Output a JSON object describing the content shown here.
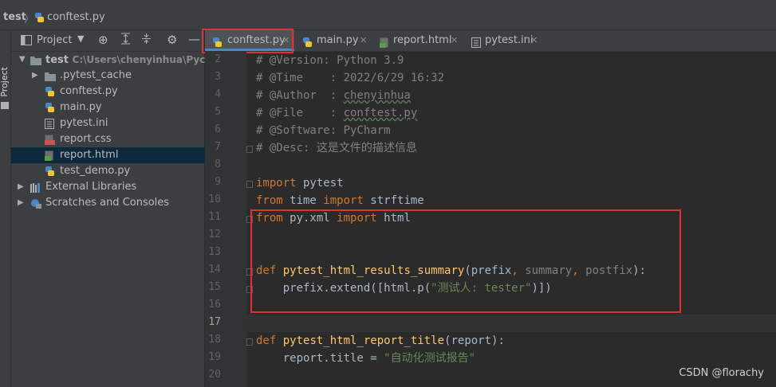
{
  "breadcrumb": {
    "project": "test",
    "file": "conftest.py"
  },
  "left_strip": {
    "label": "Project"
  },
  "project_panel": {
    "view_label": "Project",
    "tree": [
      {
        "label": "test",
        "path": "C:\\Users\\chenyinhua\\Pycharm",
        "kind": "project-folder"
      },
      {
        "label": ".pytest_cache",
        "kind": "folder"
      },
      {
        "label": "conftest.py",
        "kind": "python-file"
      },
      {
        "label": "main.py",
        "kind": "python-file"
      },
      {
        "label": "pytest.ini",
        "kind": "ini-file"
      },
      {
        "label": "report.css",
        "kind": "css-file"
      },
      {
        "label": "report.html",
        "kind": "html-file",
        "selected": true
      },
      {
        "label": "test_demo.py",
        "kind": "python-file"
      },
      {
        "label": "External Libraries",
        "kind": "libraries"
      },
      {
        "label": "Scratches and Consoles",
        "kind": "scratches"
      }
    ]
  },
  "tabs": [
    {
      "label": "conftest.py",
      "active": true
    },
    {
      "label": "main.py"
    },
    {
      "label": "report.html"
    },
    {
      "label": "pytest.ini"
    }
  ],
  "editor": {
    "current_line": 17,
    "line_numbers": [
      "2",
      "3",
      "4",
      "5",
      "6",
      "7",
      "8",
      "9",
      "10",
      "11",
      "12",
      "13",
      "14",
      "15",
      "16",
      "17",
      "18",
      "19",
      "20"
    ]
  },
  "code": {
    "l2": "# @Version: Python 3.9",
    "l3": "# @Time    : 2022/6/29 16:32",
    "l4a": "# @Author  : ",
    "l4b": "chenyinhua",
    "l5a": "# @File    : ",
    "l5b": "conftest.py",
    "l6": "# @Software: PyCharm",
    "l7": "# @Desc: 这是文件的描述信息",
    "kw_import": "import",
    "kw_from": "from",
    "kw_def": "def",
    "l9_mod": " pytest",
    "l10_mod": " time ",
    "l10_name": " strftime",
    "l11_mod": " py.xml ",
    "l11_name": " html",
    "l14_fn": "pytest_html_results_summary",
    "l14_open": "(prefix",
    "l14_comma": ", ",
    "l14_p2": "summary",
    "l14_p3": "postfix",
    "l14_close": "):",
    "l15_pre": "    prefix.extend([html.p(",
    "l15_str": "\"测试人: tester\"",
    "l15_post": ")])",
    "l18_fn": "pytest_html_report_title",
    "l18_rest": "(report):",
    "l19_pre": "    report.title = ",
    "l19_str": "\"自动化测试报告\""
  },
  "watermark": "CSDN @florachy"
}
